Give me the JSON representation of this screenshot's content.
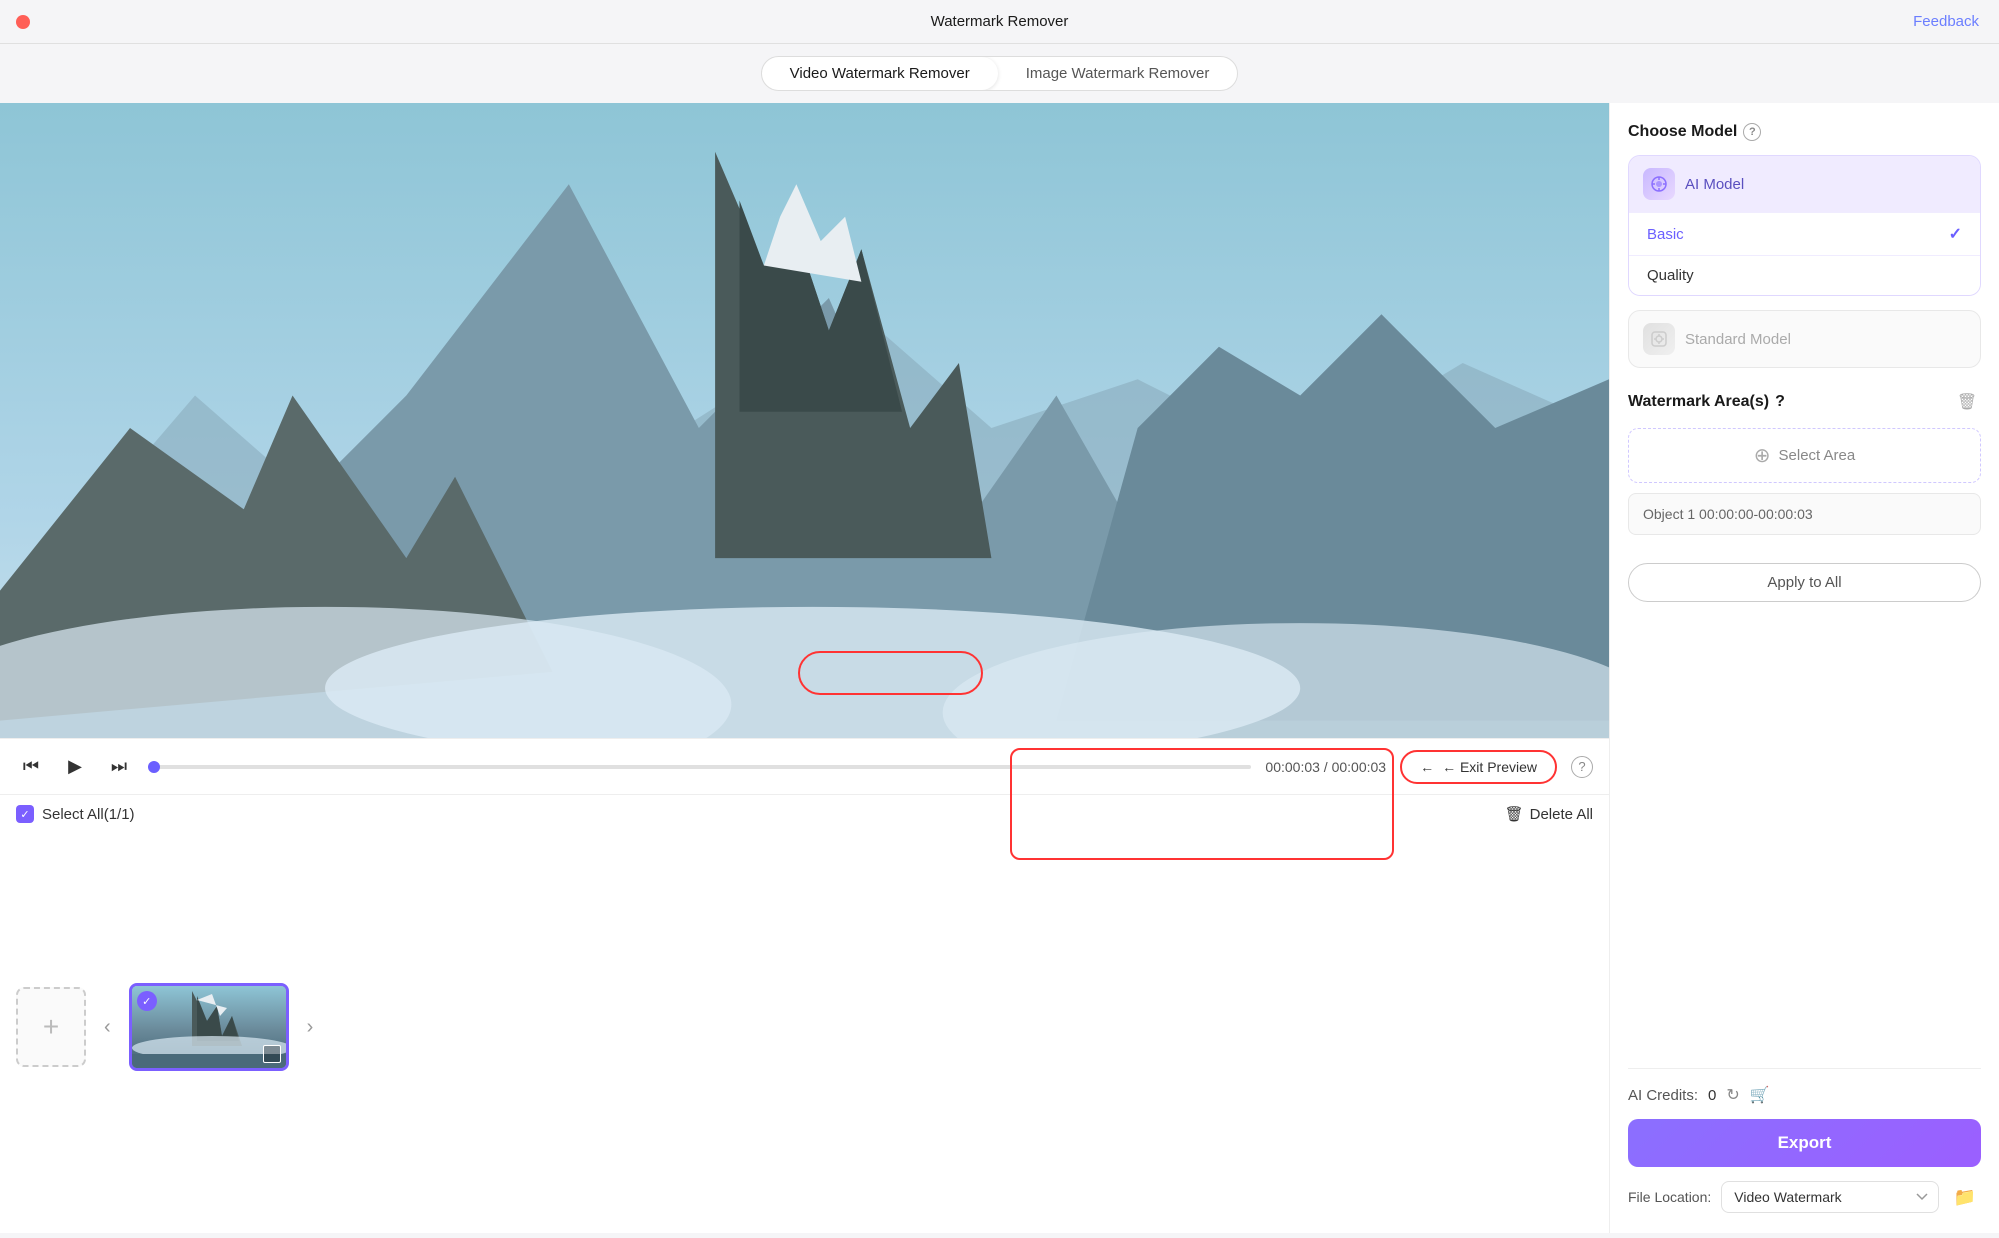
{
  "titleBar": {
    "title": "Watermark Remover",
    "feedback": "Feedback",
    "trafficLight": "close"
  },
  "tabs": {
    "items": [
      {
        "label": "Video Watermark Remover",
        "active": true
      },
      {
        "label": "Image Watermark Remover",
        "active": false
      }
    ]
  },
  "videoPlayer": {
    "currentTime": "00:00:03",
    "totalTime": "00:00:03",
    "exitPreview": "← Exit Preview"
  },
  "fileStrip": {
    "selectAll": "Select All(1/1)",
    "deleteAll": "Delete All"
  },
  "rightPanel": {
    "chooseModel": "Choose Model",
    "aiModel": "AI Model",
    "basic": "Basic",
    "quality": "Quality",
    "standardModel": "Standard Model",
    "watermarkAreas": "Watermark Area(s)",
    "selectArea": "Select Area",
    "objectItem": "Object 1  00:00:00-00:00:03",
    "applyToAll": "Apply to All",
    "aiCredits": "AI Credits:",
    "creditsValue": "0",
    "export": "Export",
    "fileLocationLabel": "File Location:",
    "fileLocationValue": "Video Watermark"
  },
  "icons": {
    "close": "●",
    "play": "▶",
    "stepBack": "⏮",
    "stepForward": "⏭",
    "trash": "🗑",
    "plus": "+",
    "folder": "📁",
    "refresh": "↻",
    "cart": "🛒",
    "check": "✓",
    "question": "?",
    "selectAreaPlus": "⊕",
    "leftArrow": "←",
    "rightArrow": "→"
  }
}
